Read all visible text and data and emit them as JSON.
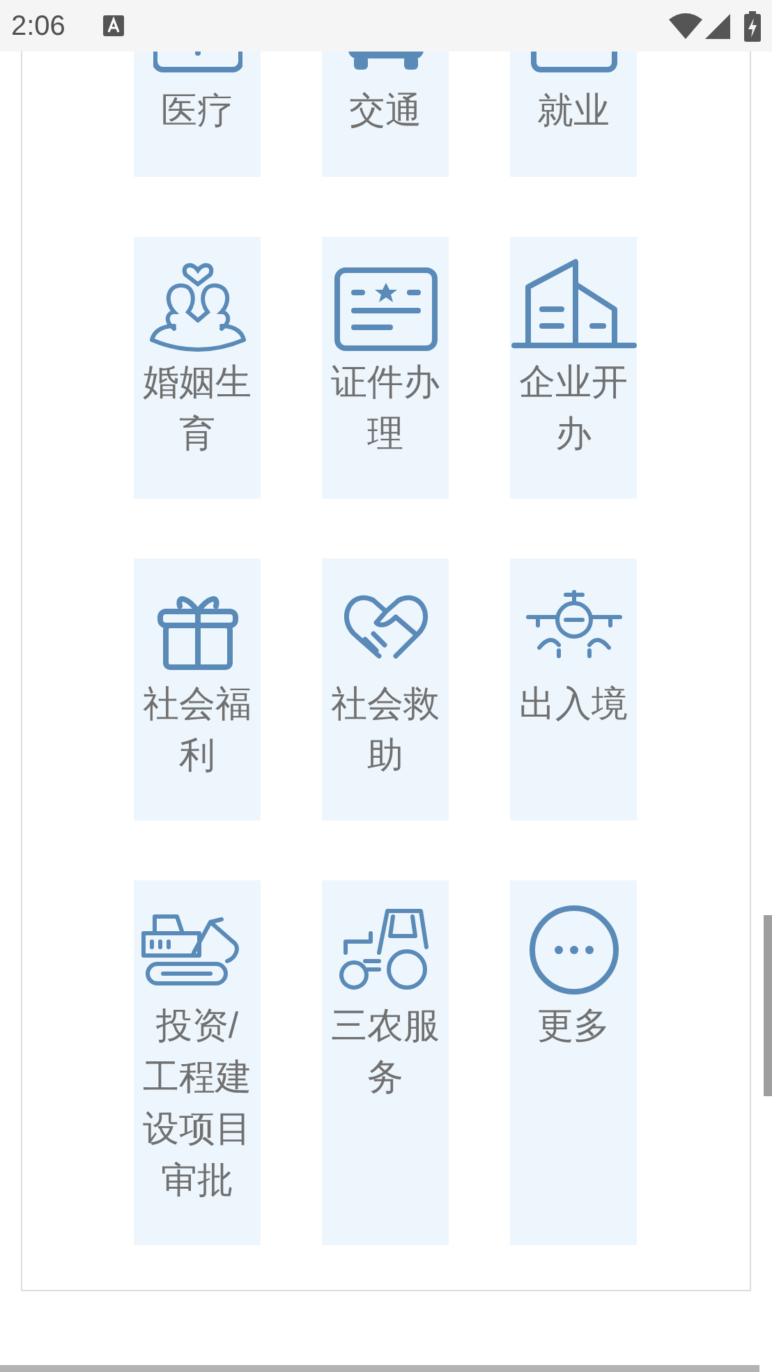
{
  "status_bar": {
    "time": "2:06"
  },
  "services": [
    {
      "label": "医疗"
    },
    {
      "label": "交通"
    },
    {
      "label": "就业"
    },
    {
      "label": "婚姻生育"
    },
    {
      "label": "证件办理"
    },
    {
      "label": "企业开办"
    },
    {
      "label": "社会福利"
    },
    {
      "label": "社会救助"
    },
    {
      "label": "出入境"
    },
    {
      "label": "投资/工程建设项目审批"
    },
    {
      "label": "三农服务"
    },
    {
      "label": "更多"
    }
  ]
}
